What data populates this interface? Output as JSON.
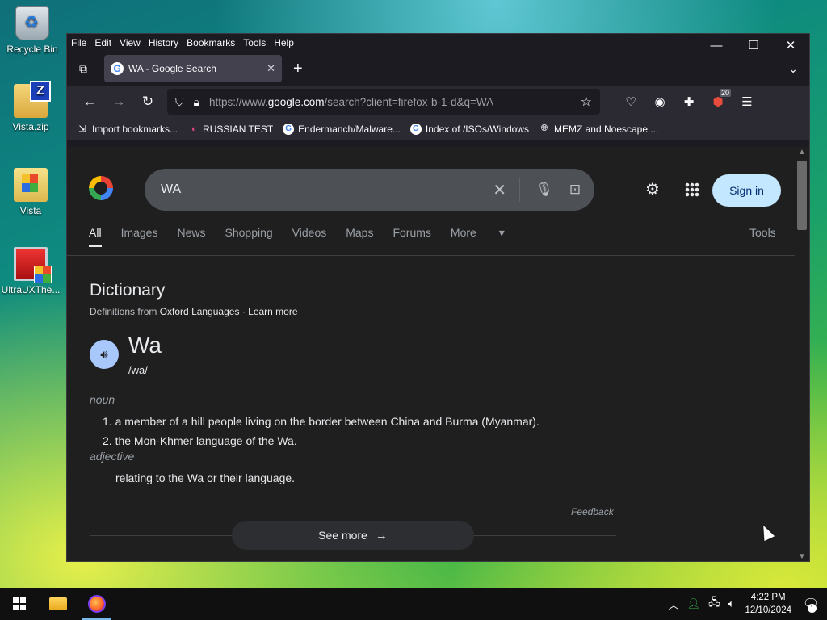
{
  "desktop": {
    "icons": [
      {
        "label": "Recycle Bin"
      },
      {
        "label": "Vista.zip"
      },
      {
        "label": "Vista"
      },
      {
        "label": "UltraUXThe..."
      }
    ]
  },
  "browser": {
    "menu": [
      "File",
      "Edit",
      "View",
      "History",
      "Bookmarks",
      "Tools",
      "Help"
    ],
    "tab_title": "WA - Google Search",
    "url_prefix": "https://www.",
    "url_domain": "google.com",
    "url_rest": "/search?client=firefox-b-1-d&q=WA",
    "extension_badge": "20",
    "bookmarks": [
      "Import bookmarks...",
      "RUSSIAN TEST",
      "Endermanch/Malware...",
      "Index of /ISOs/Windows",
      "MEMZ and Noescape ..."
    ]
  },
  "google": {
    "query": "WA",
    "sign_in": "Sign in",
    "tabs": [
      "All",
      "Images",
      "News",
      "Shopping",
      "Videos",
      "Maps",
      "Forums",
      "More"
    ],
    "tools": "Tools"
  },
  "dictionary": {
    "title": "Dictionary",
    "from_prefix": "Definitions from",
    "source": "Oxford Languages",
    "sep": "·",
    "learn_more": "Learn more",
    "word": "Wa",
    "pronunciation": "/wä/",
    "pos1": "noun",
    "def1": "1. a member of a hill people living on the border between China and Burma (Myanmar).",
    "def2": "2. the Mon-Khmer language of the Wa.",
    "pos2": "adjective",
    "def3": "relating to the Wa or their language.",
    "feedback": "Feedback",
    "see_more": "See more"
  },
  "taskbar": {
    "time": "4:22 PM",
    "date": "12/10/2024",
    "notification_count": "1"
  }
}
